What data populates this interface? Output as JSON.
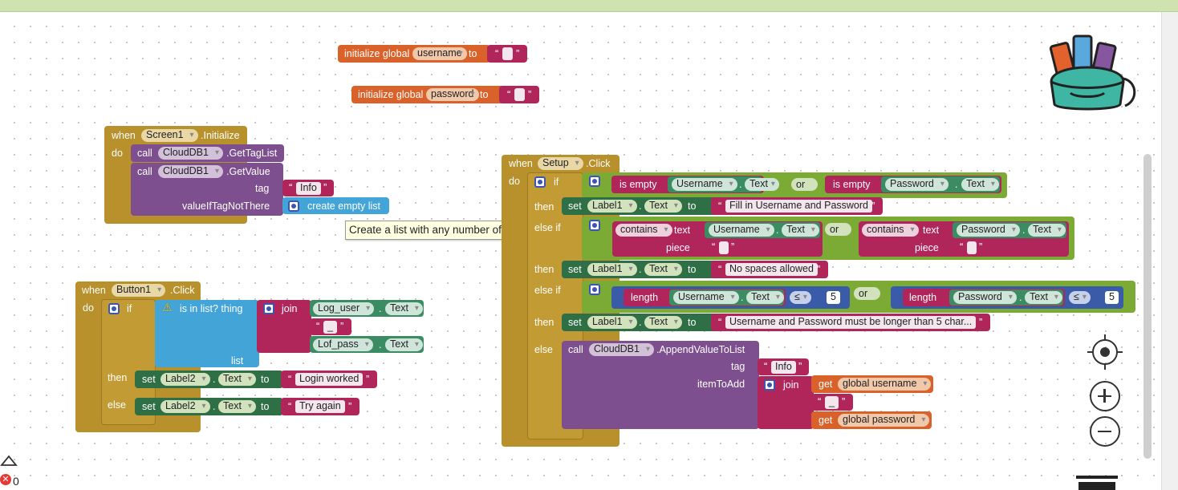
{
  "workspace": {
    "tooltip": "Create a list with any number of items.",
    "warning_count": "0"
  },
  "globals": [
    {
      "label": "initialize global",
      "name": "username",
      "to": "to"
    },
    {
      "label": "initialize global",
      "name": "password",
      "to": "to"
    }
  ],
  "screen_init": {
    "when": "when",
    "component": "Screen1",
    "event": ".Initialize",
    "do": "do",
    "call": "call",
    "db": "CloudDB1",
    "get_tag_list": ".GetTagList",
    "get_value": ".GetValue",
    "tag": "tag",
    "tag_value": "Info",
    "value_if": "valueIfTagNotThere",
    "create_empty_list": "create empty list"
  },
  "button_click": {
    "when": "when",
    "component": "Button1",
    "event": ".Click",
    "do": "do",
    "if": "if",
    "is_in_list": "is in list? thing",
    "join": "join",
    "log_user": "Log_user",
    "lof_pass": "Lof_pass",
    "text": "Text",
    "underscore": "_",
    "list": "list",
    "then": "then",
    "else": "else",
    "set": "set",
    "label2": "Label2",
    "dot": ".",
    "to": "to",
    "login_worked": "Login worked",
    "try_again": "Try again"
  },
  "setup_click": {
    "when": "when",
    "component": "Setup",
    "event": ".Click",
    "do": "do",
    "if": "if",
    "then": "then",
    "else_if": "else if",
    "else": "else",
    "is_empty": "is empty",
    "or": "or",
    "username": "Username",
    "password": "Password",
    "text": "Text",
    "set": "set",
    "label1": "Label1",
    "to": "to",
    "dot": ".",
    "fill_msg": "Fill in Username and Password",
    "contains": "contains",
    "text_word": "text",
    "piece": "piece",
    "no_spaces": "No spaces allowed",
    "length": "length",
    "lte": "≤",
    "five": "5",
    "length_msg": "Username and Password must be longer than 5 char...",
    "call": "call",
    "db": "CloudDB1",
    "append": ".AppendValueToList",
    "tag": "tag",
    "info": "Info",
    "item_to_add": "itemToAdd",
    "join": "join",
    "get": "get",
    "global_username": "global username",
    "global_password": "global password",
    "underscore": "_"
  },
  "colors": {
    "control": "#b8902c",
    "procedure": "#7e4f8f",
    "text": "#b0265a",
    "variable": "#d9622b",
    "logic": "#7bab35",
    "component_setter": "#2f6f45",
    "math": "#3a5ba8",
    "list": "#43a4d8"
  }
}
